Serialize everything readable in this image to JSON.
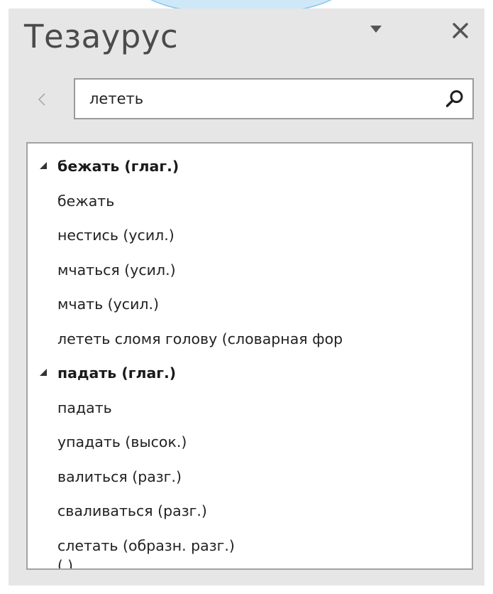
{
  "pane": {
    "title": "Тезаурус"
  },
  "search": {
    "value": "лететь"
  },
  "icons": {
    "options": "chevron-down-icon",
    "close": "close-icon",
    "back": "chevron-left-icon",
    "search": "search-icon",
    "group_expanded": "expanded-triangle-icon"
  },
  "colors": {
    "pane_background": "#e6e6e6",
    "title_text": "#4b4b4b",
    "list_background": "#ffffff",
    "accent_arc": "#cfe8f8",
    "accent_arc_border": "#8ccbef"
  },
  "results": [
    {
      "text": "бежать (глаг.)",
      "type": "header"
    },
    {
      "text": "бежать",
      "type": "item"
    },
    {
      "text": "нестись (усил.)",
      "type": "item"
    },
    {
      "text": "мчаться (усил.)",
      "type": "item"
    },
    {
      "text": "мчать (усил.)",
      "type": "item"
    },
    {
      "text": "лететь сломя голову (словарная фор",
      "type": "item"
    },
    {
      "text": "падать (глаг.)",
      "type": "header"
    },
    {
      "text": "падать",
      "type": "item"
    },
    {
      "text": "упадать (высок.)",
      "type": "item"
    },
    {
      "text": "валиться (разг.)",
      "type": "item"
    },
    {
      "text": "сваливаться (разг.)",
      "type": "item"
    },
    {
      "text": "слетать (образн. разг.)",
      "type": "item"
    }
  ]
}
